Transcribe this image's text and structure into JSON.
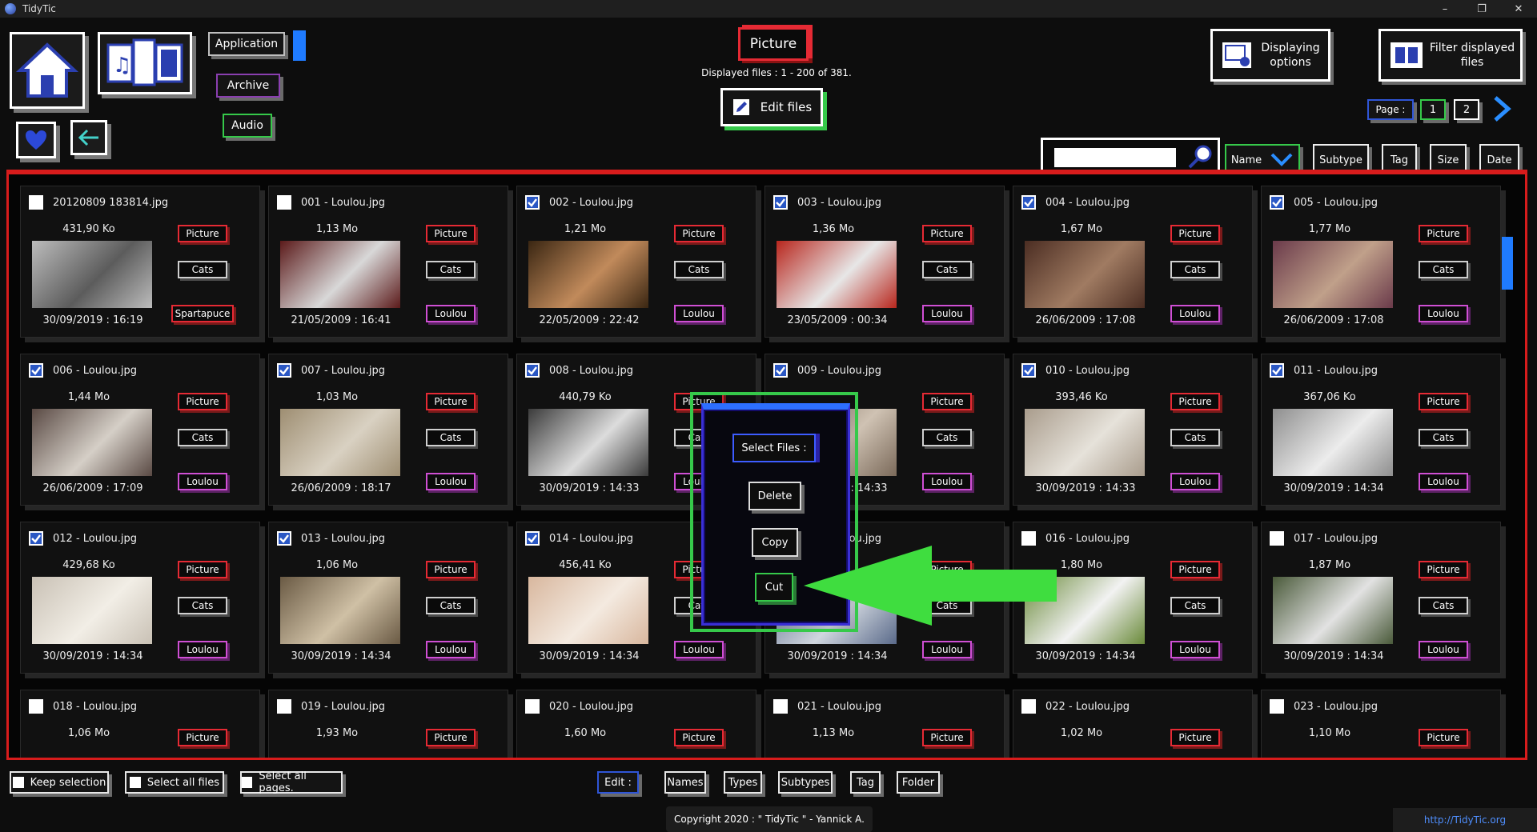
{
  "window": {
    "title": "TidyTic",
    "controls": [
      "–",
      "❐",
      "✕"
    ]
  },
  "nav": {
    "application": "Application",
    "archive": "Archive",
    "audio": "Audio"
  },
  "header": {
    "category": "Picture",
    "displayed": "Displayed files : 1 - 200 of 381.",
    "edit_files": "Edit files",
    "displaying_options": "Displaying options",
    "filter_files": "Filter displayed files",
    "page_label": "Page :",
    "pages": [
      "1",
      "2"
    ],
    "next_icon": "chevron-right-icon"
  },
  "search": {
    "value": "",
    "placeholder": ""
  },
  "sort": {
    "name": "Name",
    "subtype": "Subtype",
    "tag": "Tag",
    "size": "Size",
    "date": "Date"
  },
  "colors": {
    "accent_red": "#d81c1c",
    "accent_green": "#36c94a",
    "accent_blue": "#2d6fff",
    "tag_pink": "#cf4fd4"
  },
  "tags": {
    "type": "Picture",
    "subtype": "Cats",
    "tag_default": "Loulou",
    "tag_first": "Spartapuce"
  },
  "files": [
    {
      "name": "20120809 183814.jpg",
      "size": "431,90 Ko",
      "date": "30/09/2019 : 16:19",
      "checked": false,
      "tag": "Spartapuce"
    },
    {
      "name": "001 - Loulou.jpg",
      "size": "1,13 Mo",
      "date": "21/05/2009 : 16:41",
      "checked": false,
      "tag": "Loulou"
    },
    {
      "name": "002 - Loulou.jpg",
      "size": "1,21 Mo",
      "date": "22/05/2009 : 22:42",
      "checked": true,
      "tag": "Loulou"
    },
    {
      "name": "003 - Loulou.jpg",
      "size": "1,36 Mo",
      "date": "23/05/2009 : 00:34",
      "checked": true,
      "tag": "Loulou"
    },
    {
      "name": "004 - Loulou.jpg",
      "size": "1,67 Mo",
      "date": "26/06/2009 : 17:08",
      "checked": true,
      "tag": "Loulou"
    },
    {
      "name": "005 - Loulou.jpg",
      "size": "1,77 Mo",
      "date": "26/06/2009 : 17:08",
      "checked": true,
      "tag": "Loulou"
    },
    {
      "name": "006 - Loulou.jpg",
      "size": "1,44 Mo",
      "date": "26/06/2009 : 17:09",
      "checked": true,
      "tag": "Loulou"
    },
    {
      "name": "007 - Loulou.jpg",
      "size": "1,03 Mo",
      "date": "26/06/2009 : 18:17",
      "checked": true,
      "tag": "Loulou"
    },
    {
      "name": "008 - Loulou.jpg",
      "size": "440,79 Ko",
      "date": "30/09/2019 : 14:33",
      "checked": true,
      "tag": "Loulou"
    },
    {
      "name": "009 - Loulou.jpg",
      "size": "",
      "date": "30/09/2019 : 14:33",
      "checked": true,
      "tag": "Loulou"
    },
    {
      "name": "010 - Loulou.jpg",
      "size": "393,46 Ko",
      "date": "30/09/2019 : 14:33",
      "checked": true,
      "tag": "Loulou"
    },
    {
      "name": "011 - Loulou.jpg",
      "size": "367,06 Ko",
      "date": "30/09/2019 : 14:34",
      "checked": true,
      "tag": "Loulou"
    },
    {
      "name": "012 - Loulou.jpg",
      "size": "429,68 Ko",
      "date": "30/09/2019 : 14:34",
      "checked": true,
      "tag": "Loulou"
    },
    {
      "name": "013 - Loulou.jpg",
      "size": "1,06 Mo",
      "date": "30/09/2019 : 14:34",
      "checked": true,
      "tag": "Loulou"
    },
    {
      "name": "014 - Loulou.jpg",
      "size": "456,41 Ko",
      "date": "30/09/2019 : 14:34",
      "checked": true,
      "tag": "Loulou"
    },
    {
      "name": "015 - Loulou.jpg",
      "size": "",
      "date": "30/09/2019 : 14:34",
      "checked": true,
      "tag": "Loulou"
    },
    {
      "name": "016 - Loulou.jpg",
      "size": "1,80 Mo",
      "date": "30/09/2019 : 14:34",
      "checked": false,
      "tag": "Loulou"
    },
    {
      "name": "017 - Loulou.jpg",
      "size": "1,87 Mo",
      "date": "30/09/2019 : 14:34",
      "checked": false,
      "tag": "Loulou"
    },
    {
      "name": "018 - Loulou.jpg",
      "size": "1,06 Mo",
      "date": "",
      "checked": false,
      "tag": "Loulou"
    },
    {
      "name": "019 - Loulou.jpg",
      "size": "1,93 Mo",
      "date": "",
      "checked": false,
      "tag": "Loulou"
    },
    {
      "name": "020 - Loulou.jpg",
      "size": "1,60 Mo",
      "date": "",
      "checked": false,
      "tag": "Loulou"
    },
    {
      "name": "021 - Loulou.jpg",
      "size": "1,13 Mo",
      "date": "",
      "checked": false,
      "tag": "Loulou"
    },
    {
      "name": "022 - Loulou.jpg",
      "size": "1,02 Mo",
      "date": "",
      "checked": false,
      "tag": "Loulou"
    },
    {
      "name": "023 - Loulou.jpg",
      "size": "1,10 Mo",
      "date": "",
      "checked": false,
      "tag": "Loulou"
    }
  ],
  "popup": {
    "select_files": "Select Files :",
    "delete": "Delete",
    "copy": "Copy",
    "cut": "Cut"
  },
  "bottom": {
    "keep_selection": "Keep selection",
    "select_all_files": "Select all files",
    "select_all_pages": "Select all pages.",
    "edit": "Edit :",
    "names": "Names",
    "types": "Types",
    "subtypes": "Subtypes",
    "tag": "Tag",
    "folder": "Folder"
  },
  "footer": {
    "copyright": "Copyright 2020 : \" TidyTic \" - Yannick A.",
    "url": "http://TidyTic.org"
  }
}
